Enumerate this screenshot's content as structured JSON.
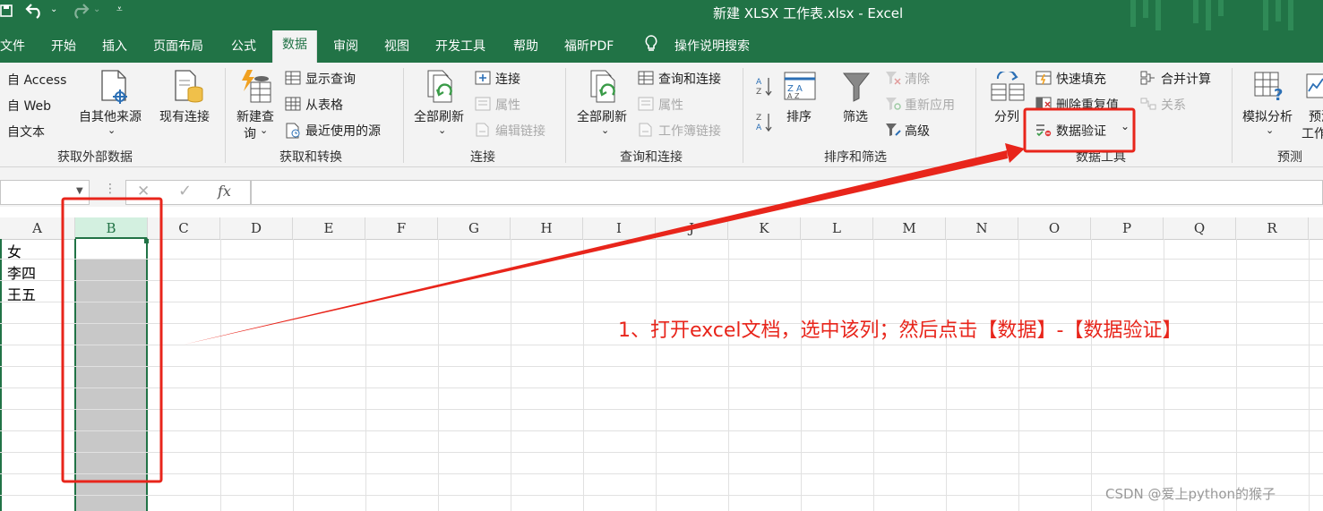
{
  "window": {
    "title": "新建 XLSX 工作表.xlsx  -  Excel"
  },
  "ribbon_tabs": [
    {
      "label": "文件"
    },
    {
      "label": "开始"
    },
    {
      "label": "插入"
    },
    {
      "label": "页面布局"
    },
    {
      "label": "公式"
    },
    {
      "label": "数据",
      "active": true
    },
    {
      "label": "审阅"
    },
    {
      "label": "视图"
    },
    {
      "label": "开发工具"
    },
    {
      "label": "帮助"
    },
    {
      "label": "福昕PDF"
    },
    {
      "label": "操作说明搜索"
    }
  ],
  "groups": {
    "get_external": {
      "name": "获取外部数据",
      "from_access": "自 Access",
      "from_web": "自 Web",
      "from_text": "自文本",
      "from_other": "自其他来源",
      "existing": "现有连接"
    },
    "get_transform": {
      "name": "获取和转换",
      "new_query": "新建查",
      "new_query_2": "询",
      "show_queries": "显示查询",
      "from_table": "从表格",
      "recent_sources": "最近使用的源"
    },
    "connections": {
      "name": "连接",
      "refresh_all": "全部刷新",
      "connections": "连接",
      "properties": "属性",
      "edit_links": "编辑链接"
    },
    "queries_connections": {
      "name": "查询和连接",
      "refresh_all": "全部刷新",
      "queries_connections": "查询和连接",
      "properties": "属性",
      "workbook_links": "工作簿链接"
    },
    "sort_filter": {
      "name": "排序和筛选",
      "sort": "排序",
      "filter": "筛选",
      "clear": "清除",
      "reapply": "重新应用",
      "advanced": "高级"
    },
    "data_tools": {
      "name": "数据工具",
      "text_to_columns": "分列",
      "flash_fill": "快速填充",
      "remove_duplicates": "删除重复值",
      "data_validation": "数据验证",
      "consolidate": "合并计算",
      "relationships": "关系"
    },
    "forecast": {
      "name": "预测",
      "what_if": "模拟分析",
      "forecast_sheet": "预测",
      "forecast_sheet_2": "工作"
    }
  },
  "formula_bar": {
    "fx": "fx",
    "cancel": "✕",
    "enter": "✓"
  },
  "columns": [
    "A",
    "B",
    "C",
    "D",
    "E",
    "F",
    "G",
    "H",
    "I",
    "J",
    "K",
    "L",
    "M",
    "N",
    "O",
    "P",
    "Q",
    "R"
  ],
  "selected_column": "B",
  "cells": [
    {
      "ref": "A1",
      "value": "女"
    },
    {
      "ref": "A2",
      "value": "李四"
    },
    {
      "ref": "A3",
      "value": "王五"
    }
  ],
  "annotation": "1、打开excel文档，选中该列；然后点击【数据】-【数据验证】",
  "watermark": "CSDN @爱上python的猴子",
  "colors": {
    "excel_green": "#217346",
    "highlight_red": "#e8251b",
    "selection_gray": "#c8c8c8"
  }
}
